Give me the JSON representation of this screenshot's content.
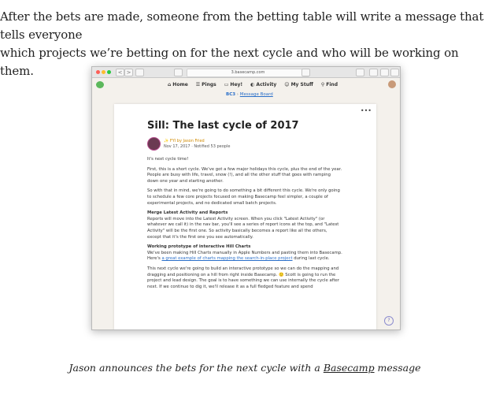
{
  "intro": {
    "line1": "After the bets are made, someone from the betting table will write a message that tells everyone",
    "line2": "which projects we’re betting on for the next cycle and who will be working on them."
  },
  "browser": {
    "url": "3.basecamp.com",
    "back_icon": "<",
    "forward_icon": ">"
  },
  "nav": {
    "items": [
      {
        "icon": "⌂",
        "label": "Home"
      },
      {
        "icon": "☰",
        "label": "Pings"
      },
      {
        "icon": "▭",
        "label": "Hey!"
      },
      {
        "icon": "◐",
        "label": "Activity"
      },
      {
        "icon": "☺",
        "label": "My Stuff"
      },
      {
        "icon": "⚲",
        "label": "Find"
      }
    ]
  },
  "breadcrumb": {
    "project": "BC3",
    "separator": " › ",
    "section": "Message Board"
  },
  "message": {
    "title": "Sill: The last cycle of 2017",
    "fyi": "✨ FYI by Jason Fried",
    "date_line": "Nov 17, 2017 · Notified 53 people",
    "paragraphs": {
      "p0": "It's next cycle time!",
      "p1": "First, this is a short cycle. We've got a few major holidays this cycle, plus the end of the year. People are busy with life, travel, snow (!), and all the other stuff that goes with ramping down one year and starting another.",
      "p2": "So with that in mind, we're going to do something a bit different this cycle. We're only going to schedule a few core projects focused on making Basecamp feel simpler, a couple of experimental projects, and no dedicated small batch projects.",
      "h1": "Merge Latest Activity and Reports",
      "p3": "Reports will move into the Latest Activity screen. When you click \"Latest Activity\" (or whatever we call it) in the nav bar, you'll see a series of report icons at the top, and \"Latest Activity\" will be the first one. So activity basically becomes a report like all the others, except that it's the first one you see automatically.",
      "h2": "Working prototype of interactive Hill Charts",
      "p4_pre": "We've been making Hill Charts manually in Apple Numbers and pasting them into Basecamp. Here's ",
      "p4_link": "a great example of charts mapping the search-in-place project",
      "p4_post": " during last cycle.",
      "p5": "This next cycle we're going to build an interactive prototype so we can do the mapping and dragging and positioning on a hill from right inside Basecamp. 🙂 Scott is going to run the project and lead design. The goal is to have something we can use internally the cycle after next. If we continue to dig it, we'll release it as a full fledged feature and spend"
    }
  },
  "caption": {
    "pre": "Jason announces the bets for the next cycle with a ",
    "link": "Basecamp",
    "post": " message"
  },
  "colors": {
    "link": "#2a6fc9",
    "app_background": "#f4f1ec"
  }
}
